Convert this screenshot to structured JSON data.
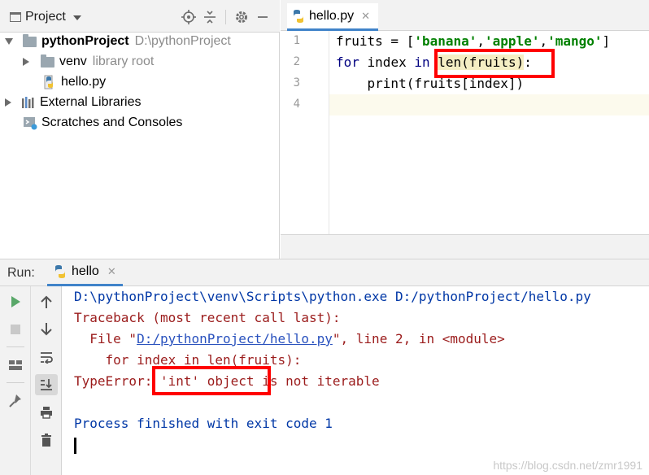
{
  "project_panel": {
    "title": "Project",
    "tree": [
      {
        "name": "pythonProject",
        "path": "D:\\pythonProject"
      },
      {
        "name": "venv",
        "note": "library root"
      },
      {
        "name": "hello.py"
      },
      {
        "name": "External Libraries"
      },
      {
        "name": "Scratches and Consoles"
      }
    ]
  },
  "editor": {
    "tab": "hello.py",
    "line_numbers": [
      "1",
      "2",
      "3",
      "4"
    ],
    "code": {
      "l1_a": "fruits = [",
      "l1_s1": "'banana'",
      "l1_c1": ",",
      "l1_s2": "'apple'",
      "l1_c2": ",",
      "l1_s3": "'mango'",
      "l1_end": "]",
      "l2_for": "for",
      "l2_mid": " index ",
      "l2_in": "in",
      "l2_sp": " ",
      "l2_call": "len(fruits)",
      "l2_end": ":",
      "l3": "    print(fruits[index])"
    }
  },
  "run_panel": {
    "label": "Run:",
    "tab": "hello",
    "output": {
      "cmd": "D:\\pythonProject\\venv\\Scripts\\python.exe D:/pythonProject/hello.py",
      "traceback": "Traceback (most recent call last):",
      "file_pre": "  File \"",
      "file_link": "D:/pythonProject/hello.py",
      "file_post": "\", line 2, in <module>",
      "src": "    for index in len(fruits):",
      "error": "TypeError: 'int' object is not iterable",
      "exit": "Process finished with exit code 1"
    }
  },
  "watermark": "https://blog.csdn.net/zmr1991",
  "colors": {
    "accent": "#4083c9",
    "annotation": "#ff0000",
    "error_text": "#9b1c1c",
    "keyword": "#000080",
    "string": "#008000"
  }
}
